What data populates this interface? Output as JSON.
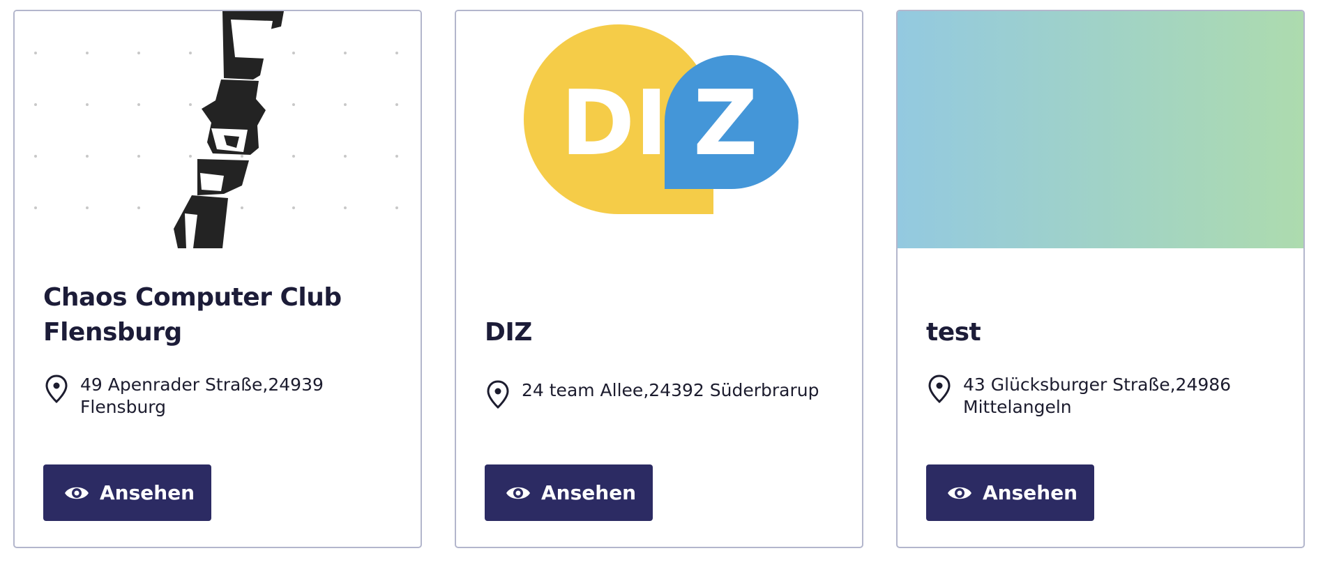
{
  "cards": [
    {
      "title_line1": "Chaos Computer Club",
      "title_line2": "Flensburg",
      "address_line1": "49 Apenrader Straße,24939",
      "address_line2": "Flensburg",
      "button_label": "Ansehen",
      "image": "chaos-computer-club-bottle-logo"
    },
    {
      "title": "DIZ",
      "address": "24 team Allee,24392 Süderbrarup",
      "button_label": "Ansehen",
      "image": "diz-logo",
      "logo": {
        "left_text": "DI",
        "right_text": "Z",
        "yellow": "#f5cc48",
        "blue": "#4496d8"
      }
    },
    {
      "title": "test",
      "address_line1": "43 Glücksburger Straße,24986",
      "address_line2": "Mittelangeln",
      "button_label": "Ansehen",
      "image": "gradient-placeholder",
      "gradient": {
        "from": "#93c9e0",
        "to": "#addbae"
      }
    }
  ],
  "colors": {
    "button_bg": "#2c2b63",
    "card_border": "#b3b6cc",
    "title_text": "#1c1c38"
  },
  "icons": {
    "address": "location-pin-icon",
    "button": "eye-icon"
  }
}
